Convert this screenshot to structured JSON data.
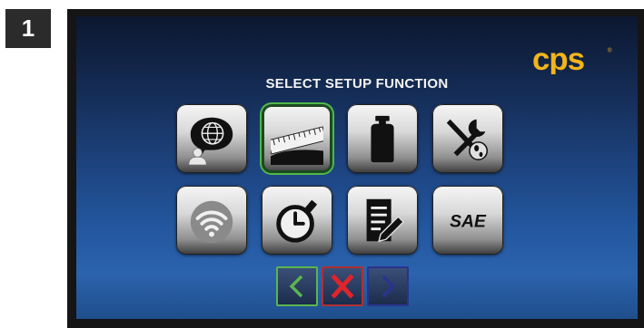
{
  "step": {
    "number": "1"
  },
  "header": {
    "brand": "CPS",
    "title": "SELECT SETUP FUNCTION"
  },
  "tiles": [
    {
      "icon": "globe-chat-icon",
      "name": "language"
    },
    {
      "icon": "ruler-icon",
      "name": "measurement",
      "selected": true
    },
    {
      "icon": "gas-tank-icon",
      "name": "refrigerant-tank"
    },
    {
      "icon": "wrench-screwdriver-icon",
      "name": "service-tools"
    },
    {
      "icon": "wifi-icon",
      "name": "wifi"
    },
    {
      "icon": "stopwatch-icon",
      "name": "timer"
    },
    {
      "icon": "notes-pencil-icon",
      "name": "notes"
    },
    {
      "icon": "sae-icon",
      "name": "sae",
      "label": "SAE"
    }
  ],
  "navigation": {
    "back": {
      "icon": "chevron-left-icon",
      "color": "#59b64e"
    },
    "cancel": {
      "icon": "close-x-icon",
      "color": "#e0242a"
    },
    "next": {
      "icon": "chevron-right-icon",
      "color": "#28348e"
    }
  },
  "colors": {
    "brand": "#f2b51a",
    "screen_top": "#0c1830",
    "screen_bottom": "#2b63ad",
    "selected_outline": "#4fb848"
  }
}
